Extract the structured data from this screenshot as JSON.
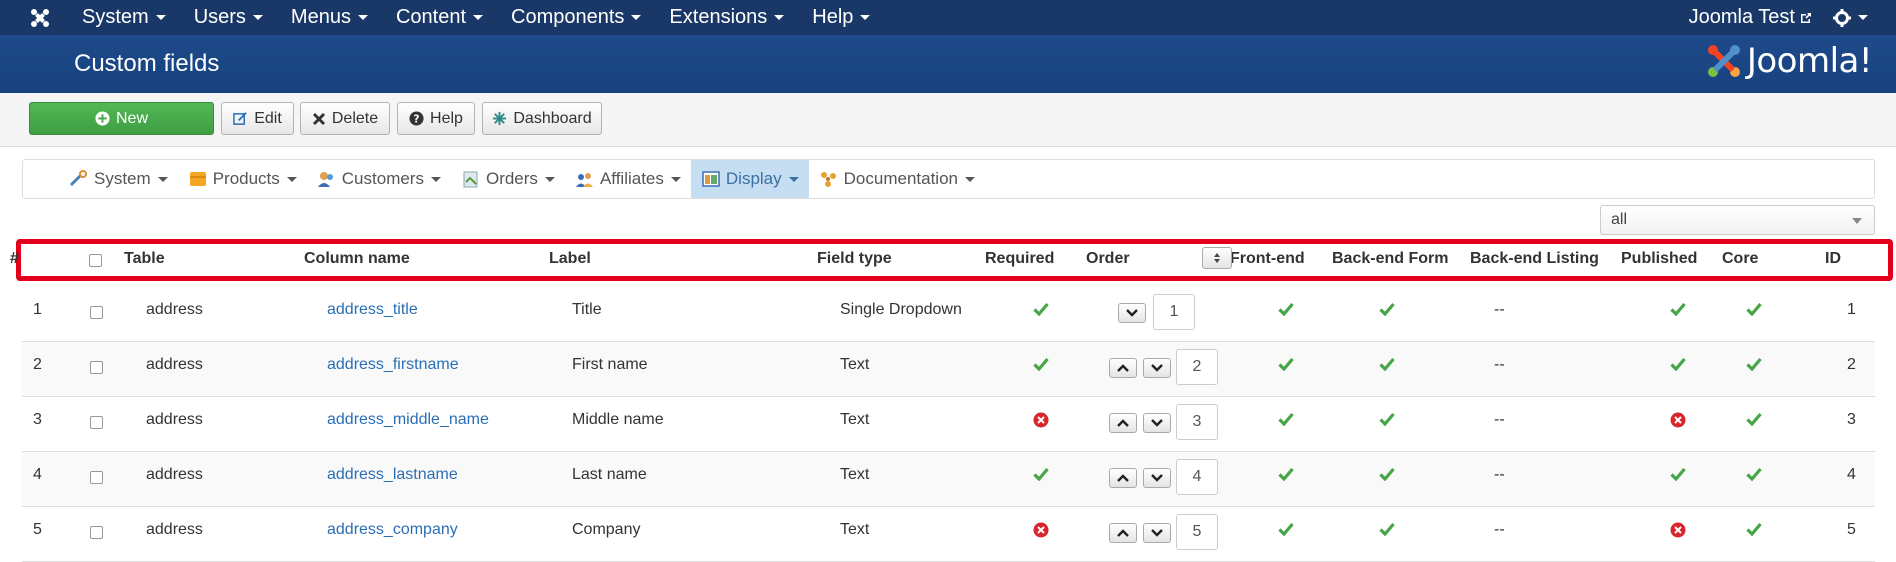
{
  "topnav": {
    "menu": [
      "System",
      "Users",
      "Menus",
      "Content",
      "Components",
      "Extensions",
      "Help"
    ],
    "site_name": "Joomla Test"
  },
  "header": {
    "title": "Custom fields",
    "brand": "Joomla!"
  },
  "toolbar": {
    "new": "New",
    "edit": "Edit",
    "delete": "Delete",
    "help": "Help",
    "dashboard": "Dashboard"
  },
  "submenu": {
    "items": [
      "System",
      "Products",
      "Customers",
      "Orders",
      "Affiliates",
      "Display",
      "Documentation"
    ],
    "active": "Display"
  },
  "filter": {
    "value": "all"
  },
  "table": {
    "headers": [
      "#",
      "Table",
      "Column name",
      "Label",
      "Field type",
      "Required",
      "Order",
      "Front-end",
      "Back-end Form",
      "Back-end Listing",
      "Published",
      "Core",
      "ID"
    ],
    "rows": [
      {
        "num": "1",
        "table": "address",
        "column": "address_title",
        "label": "Title",
        "type": "Single Dropdown",
        "required": true,
        "order": "1",
        "front": true,
        "backform": true,
        "backlisting": "--",
        "published": true,
        "core": true,
        "id": "1"
      },
      {
        "num": "2",
        "table": "address",
        "column": "address_firstname",
        "label": "First name",
        "type": "Text",
        "required": true,
        "order": "2",
        "front": true,
        "backform": true,
        "backlisting": "--",
        "published": true,
        "core": true,
        "id": "2"
      },
      {
        "num": "3",
        "table": "address",
        "column": "address_middle_name",
        "label": "Middle name",
        "type": "Text",
        "required": false,
        "order": "3",
        "front": true,
        "backform": true,
        "backlisting": "--",
        "published": false,
        "core": true,
        "id": "3"
      },
      {
        "num": "4",
        "table": "address",
        "column": "address_lastname",
        "label": "Last name",
        "type": "Text",
        "required": true,
        "order": "4",
        "front": true,
        "backform": true,
        "backlisting": "--",
        "published": true,
        "core": true,
        "id": "4"
      },
      {
        "num": "5",
        "table": "address",
        "column": "address_company",
        "label": "Company",
        "type": "Text",
        "required": false,
        "order": "5",
        "front": true,
        "backform": true,
        "backlisting": "--",
        "published": false,
        "core": true,
        "id": "5"
      }
    ]
  },
  "colors": {
    "navbar": "#1a3867",
    "header": "#1f4a8a",
    "new_button": "#46a546",
    "highlight": "#e3001b",
    "link": "#2a6fb5",
    "check": "#46a546",
    "cross": "#d9262c"
  }
}
